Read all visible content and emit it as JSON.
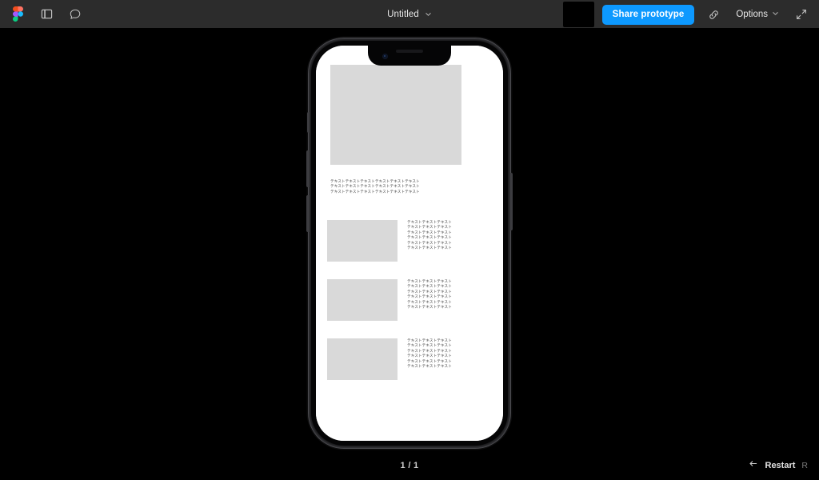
{
  "app": {
    "name": "Figma Prototype Viewer",
    "background_color": "#000000",
    "toolbar_color": "#2c2c2c",
    "accent_color": "#0d99ff"
  },
  "toolbar": {
    "logo_icon": "figma-logo-icon",
    "sidebar_toggle_icon": "sidebar-panel-icon",
    "comment_icon": "comment-bubble-icon",
    "title": "Untitled",
    "title_chevron_icon": "chevron-down-icon",
    "thumbnail_label": "",
    "share_label": "Share prototype",
    "link_icon": "link-icon",
    "options_label": "Options",
    "options_chevron_icon": "chevron-down-icon",
    "fullscreen_icon": "fullscreen-expand-icon"
  },
  "device": {
    "type": "iphone",
    "notch_icon": "notch",
    "camera_icon": "front-camera-icon",
    "speaker_icon": "earpiece-speaker-icon",
    "buttons": {
      "silent": "silent-switch",
      "volume_up": "volume-up-button",
      "volume_down": "volume-down-button",
      "power": "power-button"
    }
  },
  "screen": {
    "background_color": "#ffffff",
    "placeholder_color": "#d9d9d9",
    "hero": {
      "alt": "hero-image-placeholder"
    },
    "intro": {
      "lines": [
        "テキストテキストテキストテキストテキストテキスト",
        "テキストテキストテキストテキストテキストテキスト",
        "テキストテキストテキストテキストテキストテキスト"
      ]
    },
    "cards": [
      {
        "thumb_alt": "card-image-placeholder",
        "lines": [
          "テキストテキストテキスト",
          "テキストテキストテキスト",
          "テキストテキストテキスト",
          "テキストテキストテキスト",
          "テキストテキストテキスト",
          "テキストテキストテキスト"
        ]
      },
      {
        "thumb_alt": "card-image-placeholder",
        "lines": [
          "テキストテキストテキスト",
          "テキストテキストテキスト",
          "テキストテキストテキスト",
          "テキストテキストテキスト",
          "テキストテキストテキスト",
          "テキストテキストテキスト"
        ]
      },
      {
        "thumb_alt": "card-image-placeholder",
        "lines": [
          "テキストテキストテキスト",
          "テキストテキストテキスト",
          "テキストテキストテキスト",
          "テキストテキストテキスト",
          "テキストテキストテキスト",
          "テキストテキストテキスト"
        ]
      }
    ]
  },
  "bottombar": {
    "page_indicator": "1 / 1",
    "restart_icon": "restart-arrow-icon",
    "restart_label": "Restart",
    "restart_shortcut": "R"
  }
}
